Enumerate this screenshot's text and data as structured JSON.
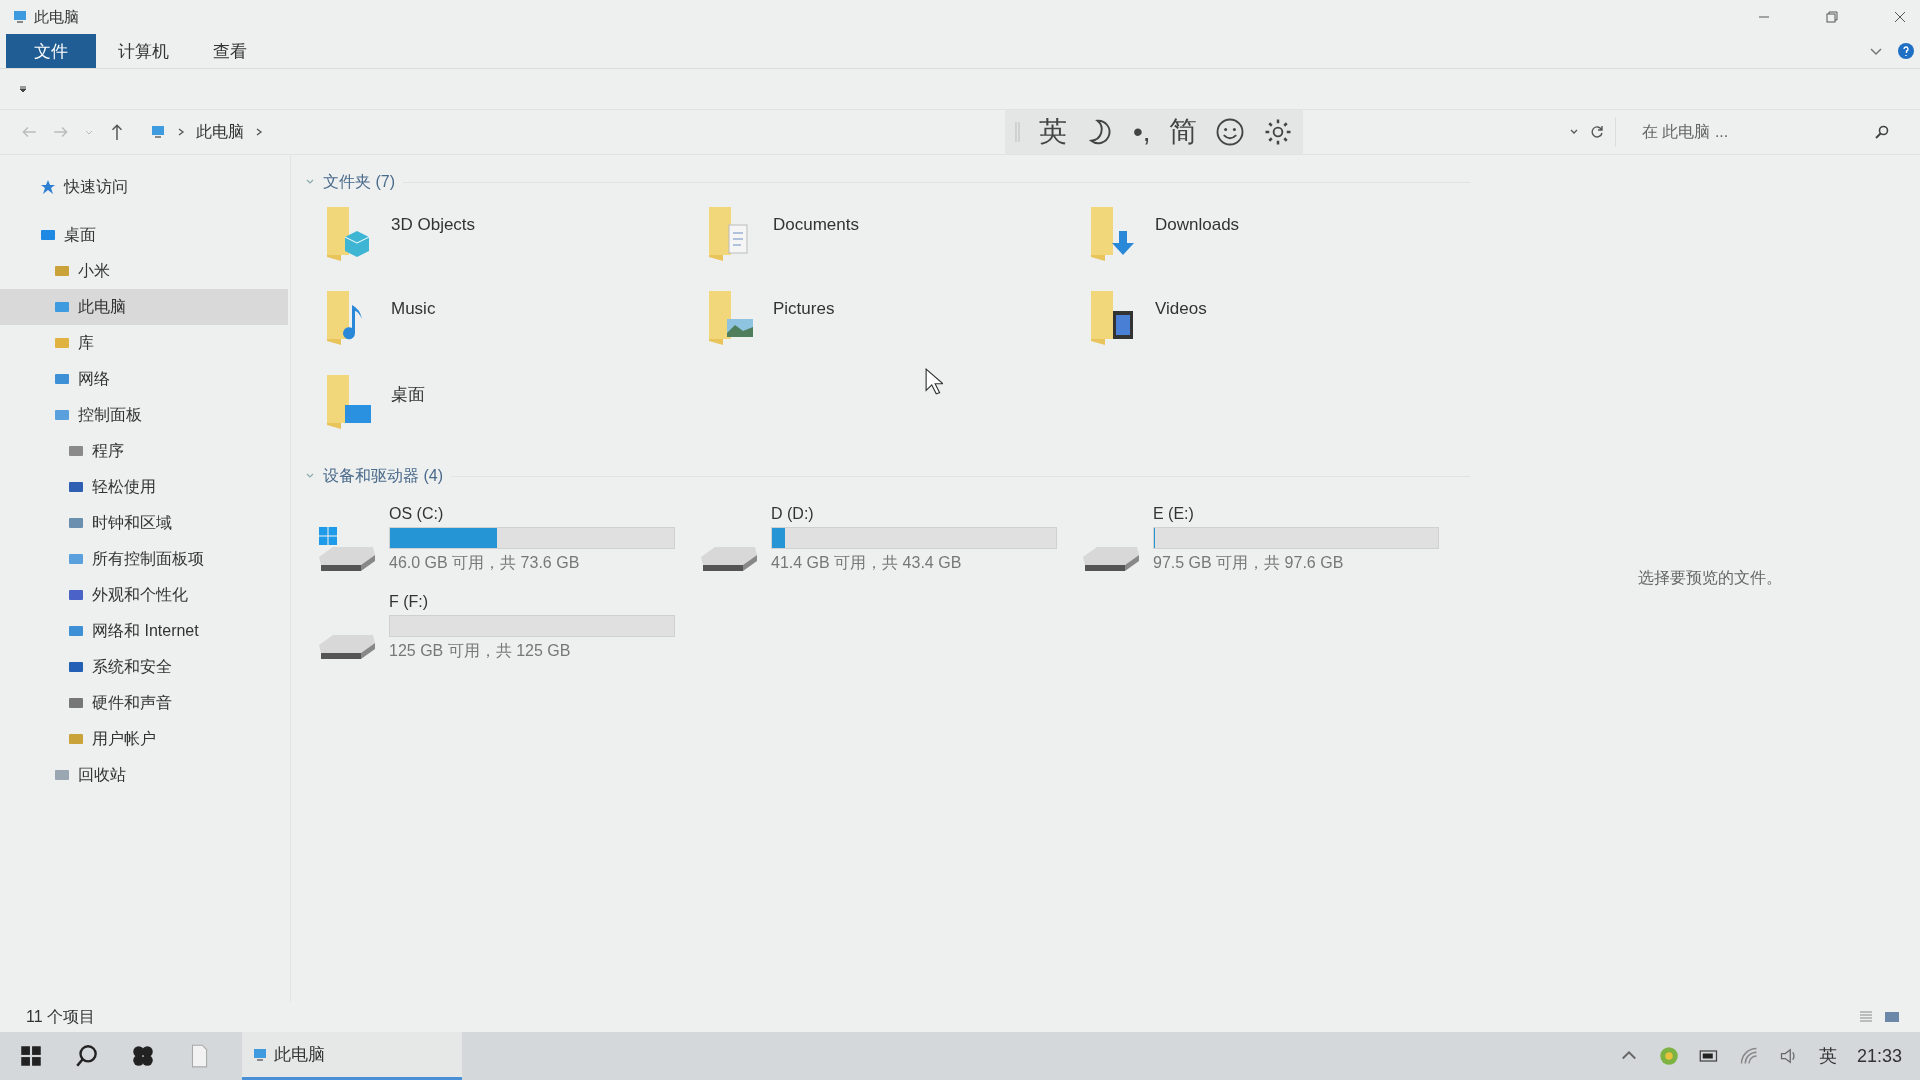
{
  "window": {
    "title": "此电脑"
  },
  "ribbon_tabs": [
    {
      "label": "文件",
      "selected": true
    },
    {
      "label": "计算机",
      "selected": false
    },
    {
      "label": "查看",
      "selected": false
    }
  ],
  "address": {
    "path": [
      "此电脑"
    ]
  },
  "search": {
    "placeholder": "在 此电脑 ..."
  },
  "ime_toolbar": {
    "language": "英",
    "punctuation": "•,",
    "script": "简"
  },
  "sidebar": {
    "items": [
      {
        "label": "快速访问",
        "selected": false,
        "kind": "star"
      },
      {
        "label": "桌面",
        "selected": false,
        "kind": "desktop",
        "children": [
          {
            "label": "小米",
            "selected": false,
            "kind": "user"
          },
          {
            "label": "此电脑",
            "selected": true,
            "kind": "pc"
          },
          {
            "label": "库",
            "selected": false,
            "kind": "library"
          },
          {
            "label": "网络",
            "selected": false,
            "kind": "network"
          },
          {
            "label": "控制面板",
            "selected": false,
            "kind": "panel",
            "children": [
              {
                "label": "程序",
                "selected": false,
                "kind": "program"
              },
              {
                "label": "轻松使用",
                "selected": false,
                "kind": "access"
              },
              {
                "label": "时钟和区域",
                "selected": false,
                "kind": "clock"
              },
              {
                "label": "所有控制面板项",
                "selected": false,
                "kind": "panel"
              },
              {
                "label": "外观和个性化",
                "selected": false,
                "kind": "appearance"
              },
              {
                "label": "网络和 Internet",
                "selected": false,
                "kind": "network"
              },
              {
                "label": "系统和安全",
                "selected": false,
                "kind": "shield"
              },
              {
                "label": "硬件和声音",
                "selected": false,
                "kind": "hardware"
              },
              {
                "label": "用户帐户",
                "selected": false,
                "kind": "user"
              }
            ]
          },
          {
            "label": "回收站",
            "selected": false,
            "kind": "bin"
          }
        ]
      }
    ]
  },
  "sections": [
    {
      "title": "文件夹 (7)",
      "expanded": true,
      "kind": "folders",
      "items": [
        {
          "name": "3D Objects",
          "kind": "objects"
        },
        {
          "name": "Documents",
          "kind": "documents"
        },
        {
          "name": "Downloads",
          "kind": "downloads"
        },
        {
          "name": "Music",
          "kind": "music"
        },
        {
          "name": "Pictures",
          "kind": "pictures"
        },
        {
          "name": "Videos",
          "kind": "videos"
        },
        {
          "name": "桌面",
          "kind": "desktop"
        }
      ]
    },
    {
      "title": "设备和驱动器 (4)",
      "expanded": true,
      "kind": "drives",
      "items": [
        {
          "name": "OS (C:)",
          "kind": "system",
          "level": 0.375,
          "space": "46.0 GB 可用，共 73.6 GB"
        },
        {
          "name": "D (D:)",
          "kind": "disk",
          "level": 0.046,
          "space": "41.4 GB 可用，共 43.4 GB"
        },
        {
          "name": "E (E:)",
          "kind": "disk",
          "level": 0.001,
          "space": "97.5 GB 可用，共 97.6 GB"
        },
        {
          "name": "F (F:)",
          "kind": "disk",
          "level": 0,
          "space": "125 GB 可用，共 125 GB"
        }
      ]
    }
  ],
  "preview": {
    "message": "选择要预览的文件。"
  },
  "status_bar": {
    "count": "11 个项目"
  },
  "taskbar": {
    "apps": [
      {
        "label": "此电脑",
        "selected": true
      }
    ],
    "ime": "英",
    "time": "21:33"
  }
}
